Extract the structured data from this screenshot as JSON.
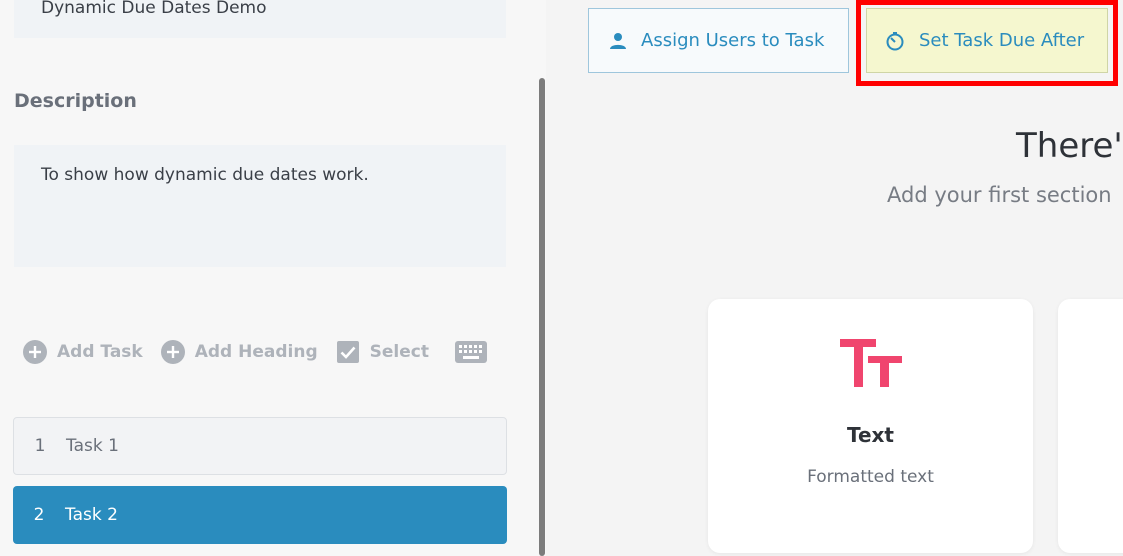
{
  "template": {
    "name": "Dynamic Due Dates Demo",
    "description_label": "Description",
    "description": "To show how dynamic due dates work."
  },
  "toolbar": {
    "add_task": "Add Task",
    "add_heading": "Add Heading",
    "select": "Select",
    "icons": [
      "plus-circle-icon",
      "plus-circle-icon",
      "checkbox-icon",
      "keyboard-icon"
    ]
  },
  "tasks": [
    {
      "number": "1",
      "name": "Task 1",
      "selected": false
    },
    {
      "number": "2",
      "name": "Task 2",
      "selected": true
    }
  ],
  "actions": {
    "assign_users": "Assign Users to Task",
    "set_due_after": "Set Task Due After"
  },
  "empty_state": {
    "title": "There's",
    "subtitle": "Add your first section"
  },
  "widgets": [
    {
      "title": "Text",
      "description": "Formatted text",
      "icon": "text-format-icon"
    }
  ],
  "colors": {
    "accent": "#2a8cbe",
    "highlight": "#ff0000",
    "text_widget_icon": "#f0456e"
  }
}
